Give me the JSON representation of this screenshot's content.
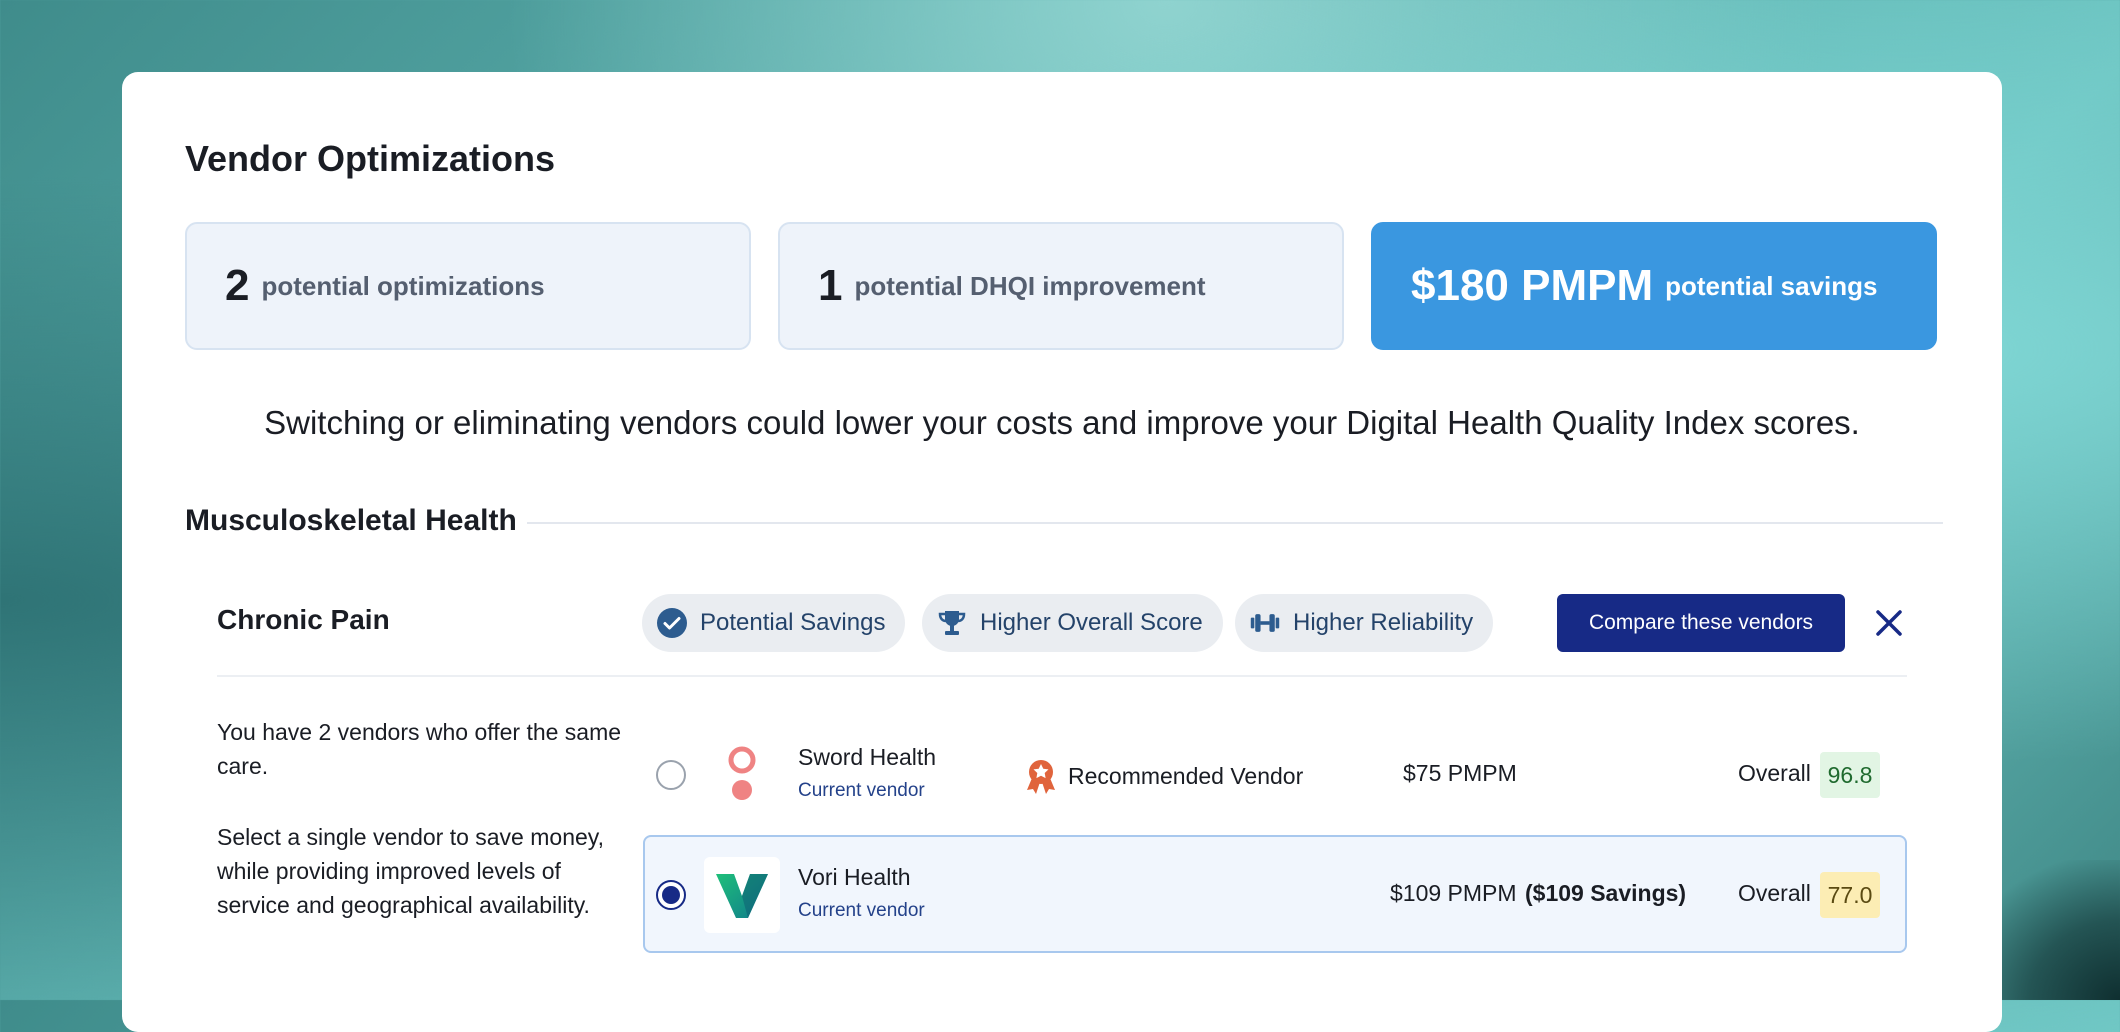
{
  "title": "Vendor Optimizations",
  "stats": [
    {
      "number": "2",
      "label": "potential optimizations"
    },
    {
      "number": "1",
      "label": "potential DHQI improvement"
    },
    {
      "number": "$180 PMPM",
      "label": "potential savings"
    }
  ],
  "subtitle": "Switching or eliminating vendors could lower your costs and improve your Digital Health Quality Index scores.",
  "section": {
    "title": "Musculoskeletal Health",
    "category": {
      "title": "Chronic Pain",
      "tags": [
        {
          "icon": "check-circle-icon",
          "label": "Potential Savings"
        },
        {
          "icon": "trophy-icon",
          "label": "Higher Overall Score"
        },
        {
          "icon": "dumbbell-icon",
          "label": "Higher Reliability"
        }
      ],
      "compare_label": "Compare these vendors",
      "description_1": "You have 2 vendors who offer the same care.",
      "description_2": "Select a single vendor to save money, while providing improved levels of service and geographical availability.",
      "vendors": [
        {
          "name": "Sword Health",
          "status": "Current vendor",
          "badge": "Recommended Vendor",
          "price": "$75 PMPM",
          "savings": "",
          "overall_label": "Overall",
          "score": "96.8",
          "selected": false
        },
        {
          "name": "Vori Health",
          "status": "Current vendor",
          "badge": "",
          "price": "$109 PMPM",
          "savings": "($109 Savings)",
          "overall_label": "Overall",
          "score": "77.0",
          "selected": true
        }
      ]
    }
  },
  "colors": {
    "accent_blue": "#3a97e0",
    "button_navy": "#172a86",
    "score_green": "#e2f5e4",
    "score_yellow": "#fcedb4"
  }
}
